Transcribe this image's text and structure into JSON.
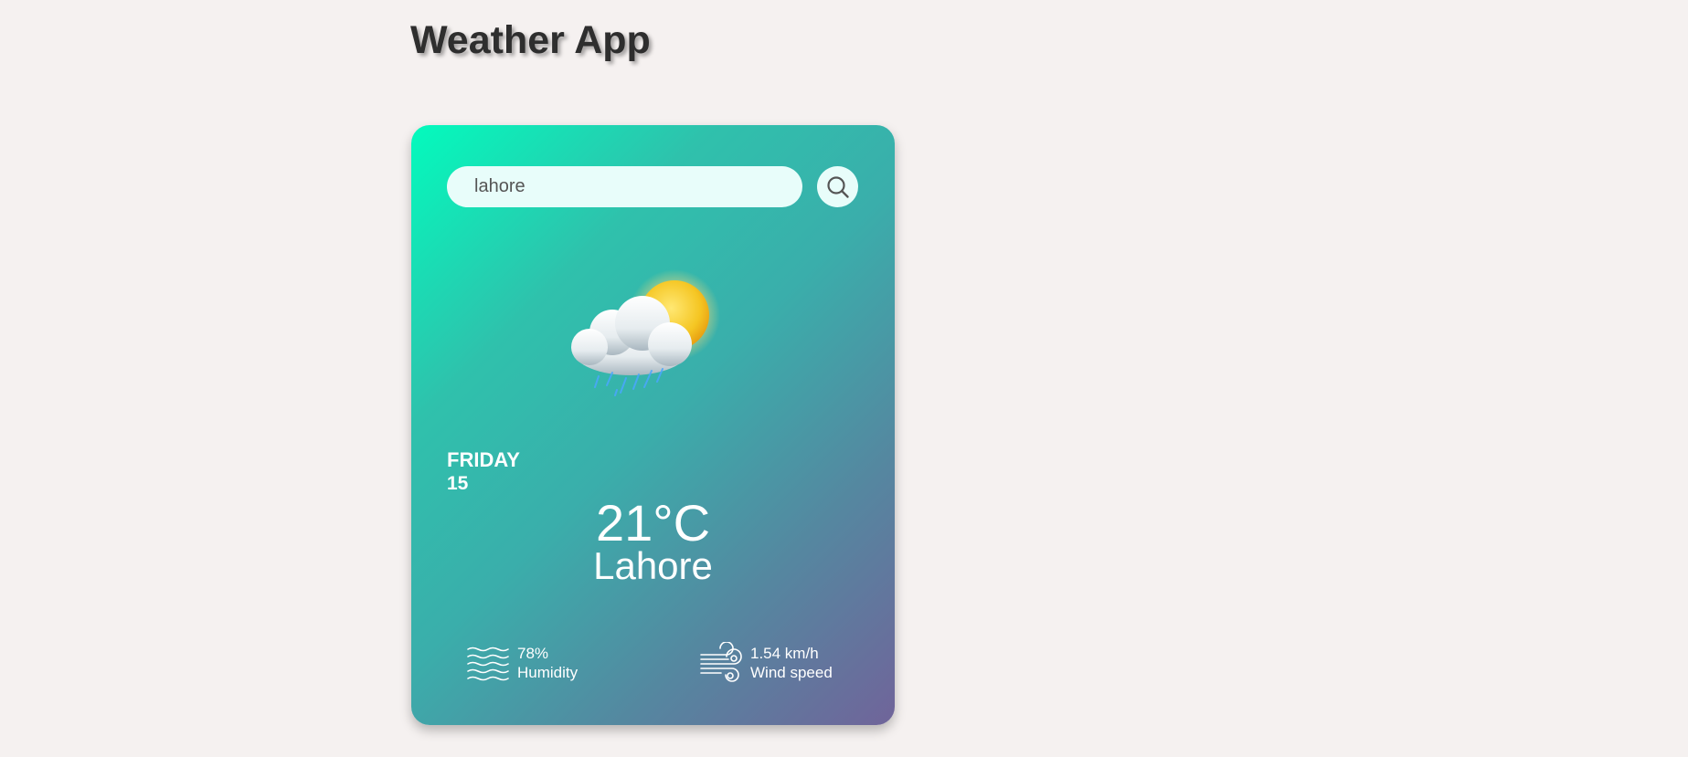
{
  "app": {
    "title": "Weather App"
  },
  "search": {
    "value": "lahore",
    "button_icon": "search-icon"
  },
  "weather": {
    "icon": "cloud-sun-rain-icon",
    "day": "FRIDAY",
    "date": "15",
    "temperature": "21°C",
    "city": "Lahore"
  },
  "details": {
    "humidity": {
      "icon": "humidity-waves-icon",
      "value": "78%",
      "label": "Humidity"
    },
    "wind": {
      "icon": "wind-icon",
      "value": "1.54 km/h",
      "label": "Wind speed"
    }
  },
  "colors": {
    "background": "#f5f1f0",
    "card_gradient_start": "#03fbbd",
    "card_gradient_end": "#70649a",
    "search_bg": "#e8fdfa",
    "title": "#2e2e2e"
  }
}
